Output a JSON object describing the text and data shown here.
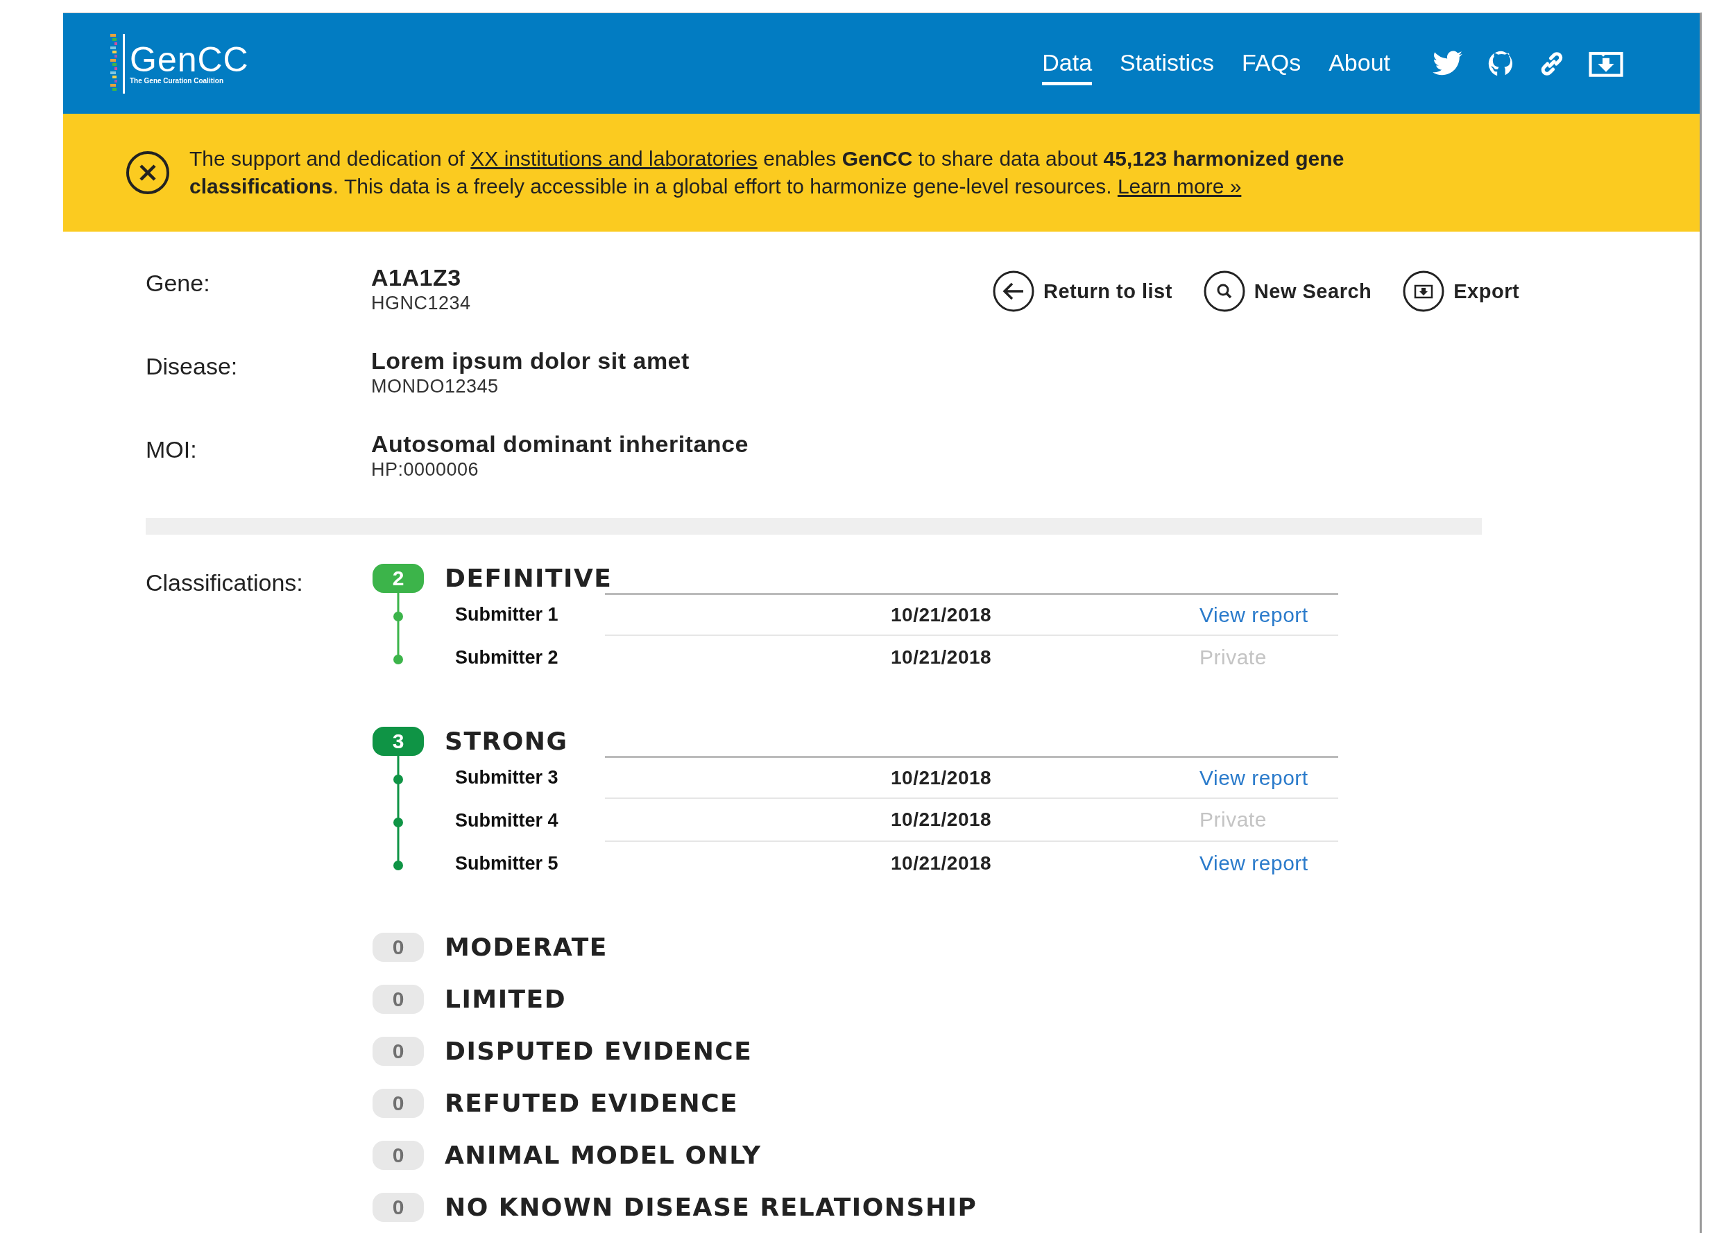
{
  "header": {
    "logo": {
      "name": "GenCC",
      "tagline": "The Gene Curation Coalition"
    },
    "nav": [
      {
        "label": "Data",
        "selected": true
      },
      {
        "label": "Statistics",
        "selected": false
      },
      {
        "label": "FAQs",
        "selected": false
      },
      {
        "label": "About",
        "selected": false
      }
    ]
  },
  "banner": {
    "parts": [
      {
        "kind": "text",
        "text": "The support and dedication of "
      },
      {
        "kind": "link",
        "text": "XX institutions and laboratories"
      },
      {
        "kind": "text",
        "text": " enables **GenCC** to share data about **45,123 harmonized gene classifications**. This data is a freely accessible in a global effort to harmonize gene-level resources. "
      },
      {
        "kind": "link",
        "text": "Learn more »"
      }
    ]
  },
  "details": [
    {
      "label": "Gene:",
      "value": "A1A1Z3",
      "id": "HGNC1234"
    },
    {
      "label": "Disease:",
      "value": "Lorem ipsum dolor sit amet",
      "id": "MONDO12345"
    },
    {
      "label": "MOI:",
      "value": "Autosomal dominant inheritance",
      "id": "HP:0000006"
    }
  ],
  "actions": [
    {
      "label": "Return to list",
      "kind": "back"
    },
    {
      "label": "New Search",
      "kind": "search"
    },
    {
      "label": "Export",
      "kind": "export"
    }
  ],
  "classifications": {
    "label": "Classifications:",
    "groups": [
      {
        "title": "DEFINITIVE",
        "count": "2",
        "color": "#3cb44a",
        "submissions": [
          {
            "submitter": "Submitter 1",
            "date": "10/21/2018",
            "report": {
              "label": "View report",
              "kind": "link"
            }
          },
          {
            "submitter": "Submitter 2",
            "date": "10/21/2018",
            "report": {
              "label": "Private",
              "kind": "private"
            }
          }
        ]
      },
      {
        "title": "STRONG",
        "count": "3",
        "color": "#0f9445",
        "submissions": [
          {
            "submitter": "Submitter 3",
            "date": "10/21/2018",
            "report": {
              "label": "View report",
              "kind": "link"
            }
          },
          {
            "submitter": "Submitter 4",
            "date": "10/21/2018",
            "report": {
              "label": "Private",
              "kind": "private"
            }
          },
          {
            "submitter": "Submitter 5",
            "date": "10/21/2018",
            "report": {
              "label": "View report",
              "kind": "link"
            }
          }
        ]
      },
      {
        "title": "MODERATE",
        "count": "0",
        "color": "#e8e8e8"
      },
      {
        "title": "LIMITED",
        "count": "0",
        "color": "#e8e8e8"
      },
      {
        "title": "DISPUTED EVIDENCE",
        "count": "0",
        "color": "#e8e8e8"
      },
      {
        "title": "REFUTED EVIDENCE",
        "count": "0",
        "color": "#e8e8e8"
      },
      {
        "title": "ANIMAL MODEL ONLY",
        "count": "0",
        "color": "#e8e8e8"
      },
      {
        "title": "NO KNOWN DISEASE RELATIONSHIP",
        "count": "0",
        "color": "#e8e8e8"
      }
    ]
  }
}
